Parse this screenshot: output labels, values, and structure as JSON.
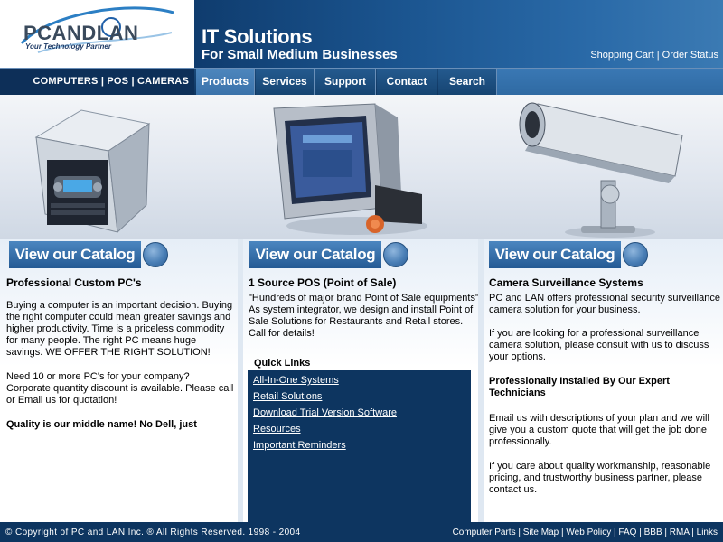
{
  "header": {
    "logo_text": "PCANDLAN",
    "logo_tagline": "Your Technology Partner",
    "banner_title": "IT Solutions",
    "banner_subtitle": "For Small Medium Businesses",
    "links": [
      "Shopping Cart",
      "Order Status"
    ],
    "link_separator": "|"
  },
  "nav": {
    "left_label": "COMPUTERS | POS | CAMERAS",
    "tabs": [
      {
        "label": "Products",
        "active": true
      },
      {
        "label": "Services",
        "active": false
      },
      {
        "label": "Support",
        "active": false
      },
      {
        "label": "Contact",
        "active": false
      },
      {
        "label": "Search",
        "active": false
      }
    ]
  },
  "hero": {
    "products": [
      "server-pc-icon",
      "pos-terminal-icon",
      "security-camera-icon"
    ]
  },
  "columns": [
    {
      "button_label": "View our Catalog",
      "title": "Professional Custom PC's",
      "paragraphs": [
        "Buying a computer is an important decision.  Buying the right computer could mean greater savings and higher productivity.  Time is a priceless commodity for many people.  The right PC means huge savings.  WE OFFER THE RIGHT SOLUTION!",
        "Need 10 or more PC's for your company? Corporate quantity discount is available.  Please call or Email us for quotation!"
      ],
      "quality": "Quality is our middle name!  No Dell, just"
    },
    {
      "button_label": "View our Catalog",
      "title": "1 Source POS (Point of Sale)",
      "paragraphs": [
        "\"Hundreds of major brand Point of Sale equipments\" As system integrator, we design and install Point of Sale Solutions for Restaurants and Retail stores. Call for details!"
      ],
      "quick_links_title": "Quick Links",
      "quick_links": [
        "All-In-One Systems",
        "Retail Solutions",
        "Download Trial Version Software",
        "Resources",
        "Important Reminders"
      ]
    },
    {
      "button_label": "View our Catalog",
      "title": "Camera Surveillance Systems",
      "paragraphs": [
        "PC and LAN offers professional security surveillance camera solution for your business.",
        "If you are looking for a professional surveillance camera solution, please consult with us to discuss your options."
      ],
      "subheading": "Professionally Installed By Our Expert Technicians",
      "paragraphs2": [
        "Email us with descriptions of your plan and we will give you a custom quote that will get the job done professionally.",
        "If you care about quality workmanship, reasonable pricing, and trustworthy business partner, please contact us."
      ]
    }
  ],
  "footer": {
    "copyright_symbol": "©",
    "copyright": "Copyright of PC and LAN Inc. ® All Rights Reserved. 1998 - 2004",
    "links": [
      "Computer Parts",
      "Site Map",
      "Web Policy",
      "FAQ",
      "BBB",
      "RMA",
      "Links"
    ]
  }
}
